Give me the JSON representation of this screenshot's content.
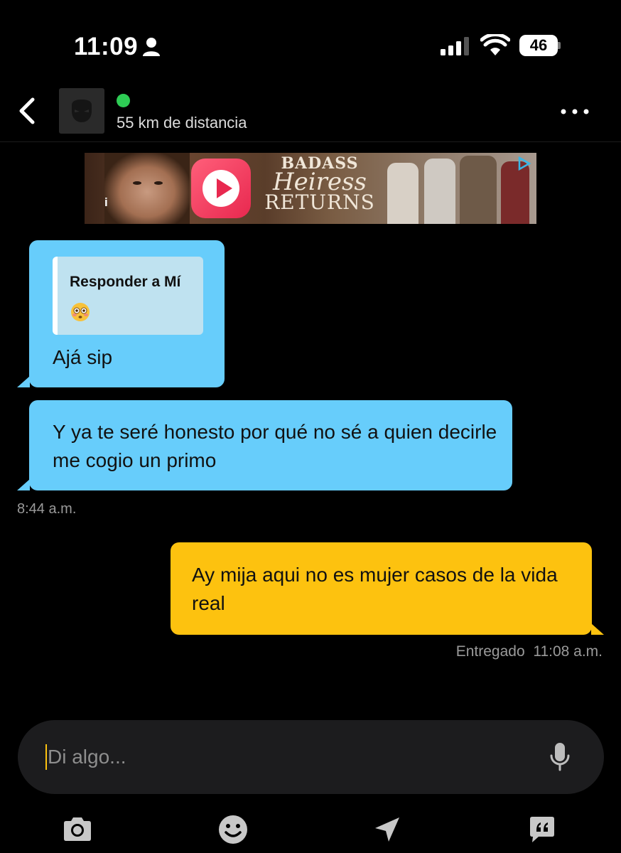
{
  "status_bar": {
    "time": "11:09",
    "battery": "46",
    "icons": [
      "person-icon",
      "signal-icon",
      "wifi-icon",
      "battery-icon"
    ]
  },
  "header": {
    "distance": "55 km de distancia",
    "online": true,
    "online_color": "#2ecc55",
    "icons": [
      "back-icon",
      "avatar-placeholder-icon",
      "more-icon"
    ]
  },
  "ad": {
    "title_line1": "BADASS",
    "title_line2": "Heiress",
    "title_line3": "RETURNS",
    "info_label": "i",
    "icons": [
      "ad-app-logo-icon",
      "adchoices-icon"
    ]
  },
  "messages": [
    {
      "direction": "incoming",
      "reply_label": "Responder a Mí",
      "reply_emoji": "flushed-face-emoji",
      "text": "Ajá sip"
    },
    {
      "direction": "incoming",
      "text": "Y ya te seré honesto por qué no sé a quien decirle me cogio un primo"
    },
    {
      "direction": "outgoing",
      "text": "Ay mija aqui no es mujer casos de la vida real"
    }
  ],
  "incoming_time": "8:44 a.m.",
  "outgoing_status": "Entregado",
  "outgoing_time": "11:08 a.m.",
  "colors": {
    "incoming_bubble": "#67cdfb",
    "outgoing_bubble": "#fdc20f",
    "background": "#000000"
  },
  "input": {
    "placeholder": "Di algo..."
  },
  "toolbar": {
    "icons": [
      "camera-icon",
      "emoji-icon",
      "location-arrow-icon",
      "saved-phrases-icon"
    ]
  }
}
